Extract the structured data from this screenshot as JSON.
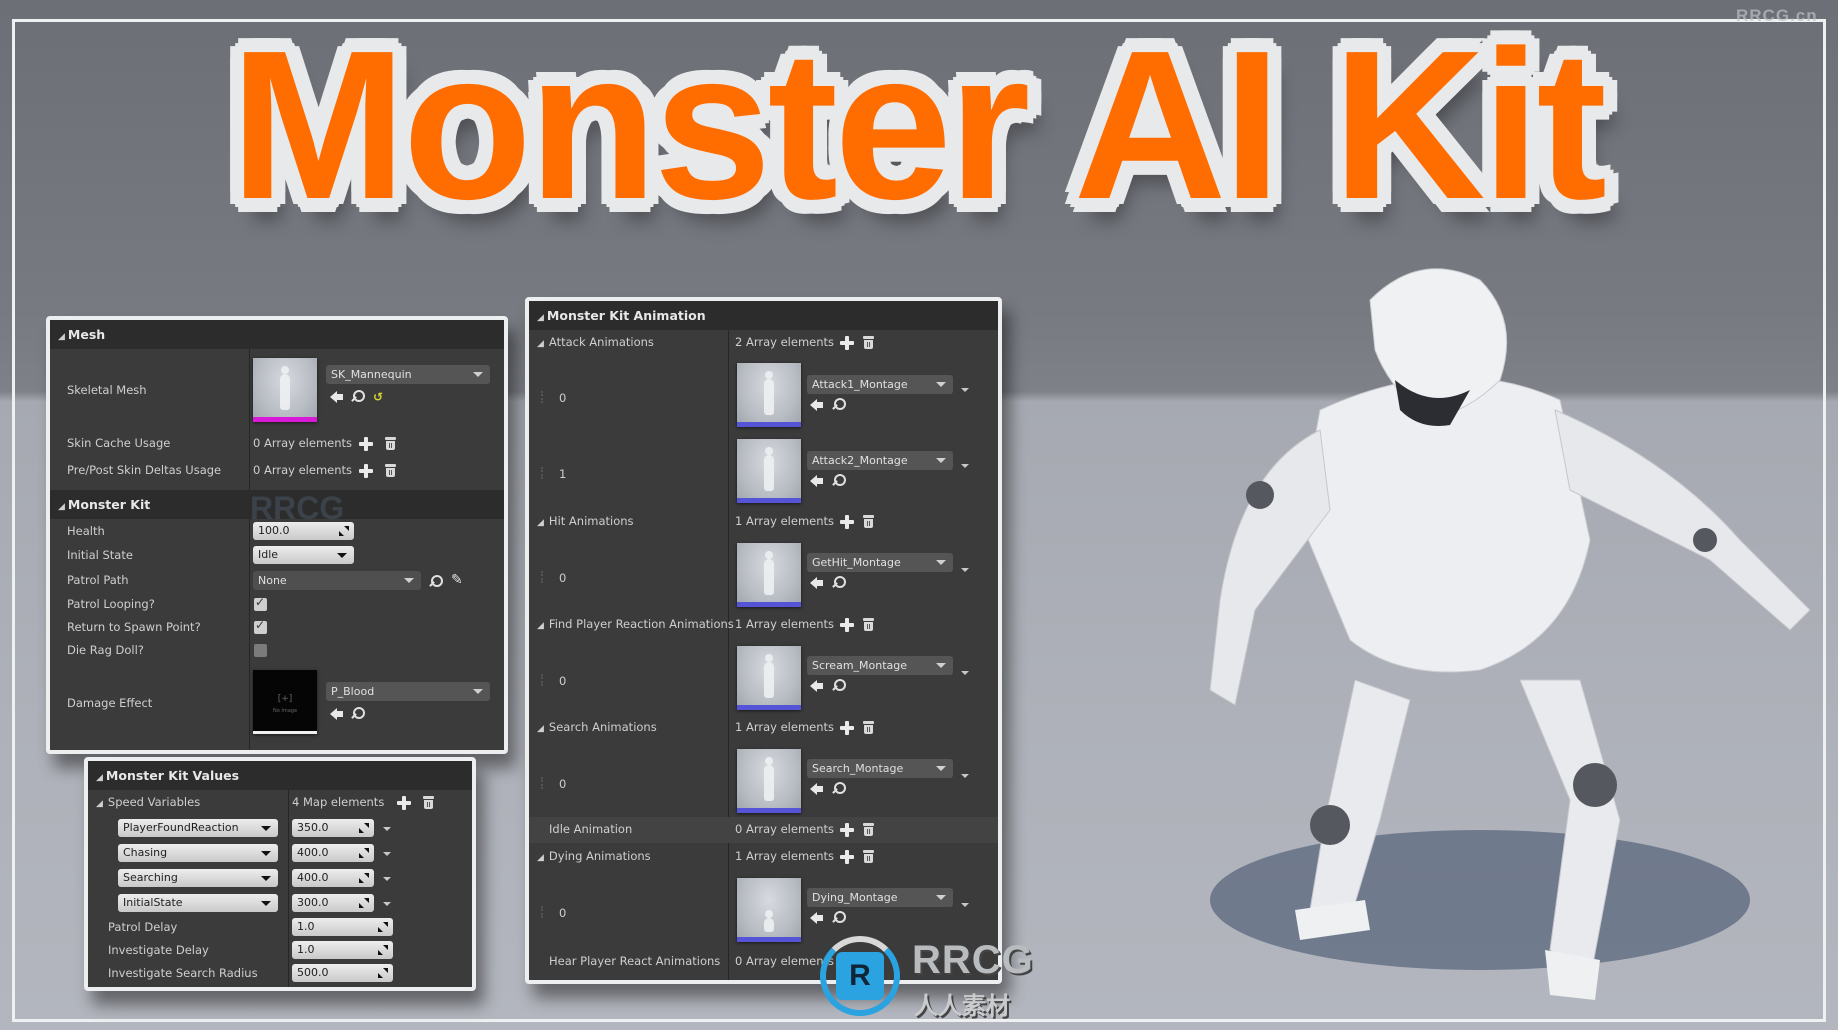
{
  "title": "Monster AI Kit",
  "watermark_top": "RRCG.cn",
  "watermark_logo": {
    "name": "RRCG",
    "subtitle": "人人素材",
    "monogram": "R"
  },
  "colors": {
    "title_orange": "#ff6d00",
    "title_outline": "#e8e9eb",
    "panel_bg": "#3b3b3b",
    "header_bg": "#2c2c2c",
    "mesh_bar": "#d81ad8",
    "anim_bar": "#5553d6",
    "logo_blue": "#2aa3e0"
  },
  "mesh_panel": {
    "header": "Mesh",
    "skeletal_mesh": {
      "label": "Skeletal Mesh",
      "value": "SK_Mannequin",
      "icons": [
        "use-selected-icon",
        "browse-icon",
        "reset-icon"
      ]
    },
    "skin_cache": {
      "label": "Skin Cache Usage",
      "value": "0 Array elements"
    },
    "pre_post": {
      "label": "Pre/Post Skin Deltas Usage",
      "value": "0 Array elements"
    },
    "kit_header": "Monster Kit",
    "health": {
      "label": "Health",
      "value": "100.0"
    },
    "initial_state": {
      "label": "Initial State",
      "value": "Idle"
    },
    "patrol_path": {
      "label": "Patrol Path",
      "value": "None"
    },
    "patrol_looping": {
      "label": "Patrol Looping?",
      "checked": true
    },
    "return_spawn": {
      "label": "Return to Spawn Point?",
      "checked": true
    },
    "die_ragdoll": {
      "label": "Die Rag Doll?",
      "checked": false
    },
    "damage_effect": {
      "label": "Damage Effect",
      "value": "P_Blood",
      "thumb_text": "[+]",
      "thumb_sub": "No Image"
    }
  },
  "values_panel": {
    "header": "Monster Kit Values",
    "speed": {
      "label": "Speed Variables",
      "count": "4 Map elements",
      "entries": [
        {
          "key": "PlayerFoundReaction",
          "value": "350.0"
        },
        {
          "key": "Chasing",
          "value": "400.0"
        },
        {
          "key": "Searching",
          "value": "400.0"
        },
        {
          "key": "InitialState",
          "value": "300.0"
        }
      ]
    },
    "patrol_delay": {
      "label": "Patrol Delay",
      "value": "1.0"
    },
    "investigate_delay": {
      "label": "Investigate Delay",
      "value": "1.0"
    },
    "investigate_radius": {
      "label": "Investigate Search Radius",
      "value": "500.0"
    }
  },
  "anim_panel": {
    "header": "Monster Kit Animation",
    "attack": {
      "label": "Attack Animations",
      "count": "2 Array elements",
      "items": [
        {
          "index": "0",
          "value": "Attack1_Montage"
        },
        {
          "index": "1",
          "value": "Attack2_Montage"
        }
      ]
    },
    "hit": {
      "label": "Hit Animations",
      "count": "1 Array elements",
      "items": [
        {
          "index": "0",
          "value": "GetHit_Montage"
        }
      ]
    },
    "find": {
      "label": "Find Player Reaction Animations",
      "count": "1 Array elements",
      "items": [
        {
          "index": "0",
          "value": "Scream_Montage"
        }
      ]
    },
    "search": {
      "label": "Search Animations",
      "count": "1 Array elements",
      "items": [
        {
          "index": "0",
          "value": "Search_Montage"
        }
      ]
    },
    "idle": {
      "label": "Idle Animation",
      "count": "0 Array elements"
    },
    "dying": {
      "label": "Dying Animations",
      "count": "1 Array elements",
      "items": [
        {
          "index": "0",
          "value": "Dying_Montage"
        }
      ]
    },
    "hear": {
      "label": "Hear Player React Animations",
      "count": "0 Array elements"
    }
  }
}
